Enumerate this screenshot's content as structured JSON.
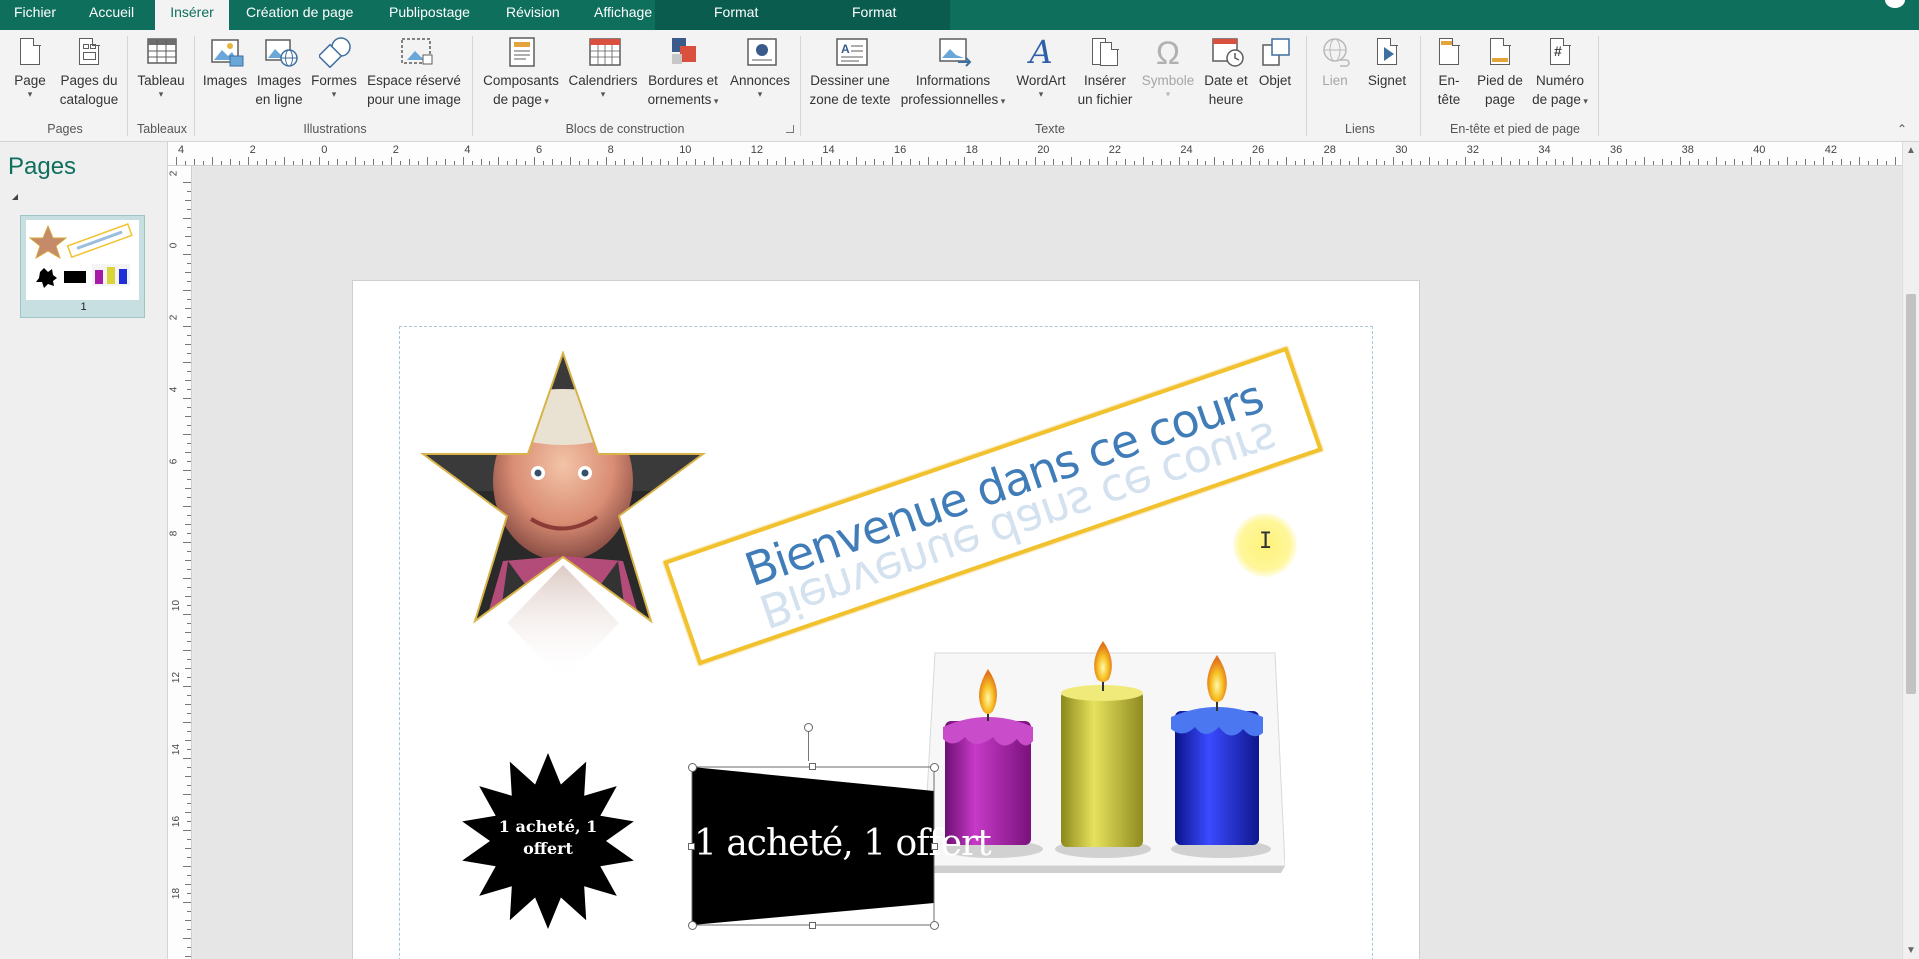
{
  "tabs": [
    {
      "label": "Fichier",
      "active": false
    },
    {
      "label": "Accueil",
      "active": false
    },
    {
      "label": "Insérer",
      "active": true
    },
    {
      "label": "Création de page",
      "active": false
    },
    {
      "label": "Publipostage",
      "active": false
    },
    {
      "label": "Révision",
      "active": false
    },
    {
      "label": "Affichage",
      "active": false
    },
    {
      "label": "Format",
      "active": false
    },
    {
      "label": "Format",
      "active": false
    }
  ],
  "ribbon": {
    "groups": {
      "pages": "Pages",
      "tableaux": "Tableaux",
      "illustrations": "Illustrations",
      "blocs": "Blocs de construction",
      "texte": "Texte",
      "liens": "Liens",
      "entete": "En-tête et pied de page"
    },
    "buttons": {
      "page": "Page",
      "pages_catalogue_1": "Pages du",
      "pages_catalogue_2": "catalogue",
      "tableau": "Tableau",
      "images": "Images",
      "images_ligne_1": "Images",
      "images_ligne_2": "en ligne",
      "formes": "Formes",
      "espace_1": "Espace réservé",
      "espace_2": "pour une image",
      "composants_1": "Composants",
      "composants_2": "de page",
      "calendriers": "Calendriers",
      "bordures_1": "Bordures et",
      "bordures_2": "ornements",
      "annonces": "Annonces",
      "dessiner_1": "Dessiner une",
      "dessiner_2": "zone de texte",
      "infos_1": "Informations",
      "infos_2": "professionnelles",
      "wordart": "WordArt",
      "inserer_fichier_1": "Insérer",
      "inserer_fichier_2": "un fichier",
      "symbole": "Symbole",
      "date_1": "Date et",
      "date_2": "heure",
      "objet": "Objet",
      "lien": "Lien",
      "signet": "Signet",
      "entete_1": "En-",
      "entete_2": "tête",
      "pied_1": "Pied de",
      "pied_2": "page",
      "numero_1": "Numéro",
      "numero_2": "de page"
    },
    "symbol_glyph": "Ω",
    "wordart_glyph": "A",
    "numero_glyph": "#"
  },
  "pages_pane": {
    "title": "Pages",
    "thumbnail_number": "1"
  },
  "ruler": {
    "h_labels": [
      "4",
      "2",
      "0",
      "2",
      "4",
      "6",
      "8",
      "10",
      "12",
      "14",
      "16",
      "18",
      "20",
      "22",
      "24",
      "26",
      "28",
      "30",
      "32",
      "34",
      "36",
      "38",
      "40",
      "42"
    ],
    "v_labels": [
      "2",
      "0",
      "2",
      "4",
      "6",
      "8",
      "10",
      "12",
      "14",
      "16",
      "18"
    ]
  },
  "document": {
    "banner_text": "Bienvenue dans ce cours",
    "burst_text_1": "1 acheté, 1",
    "burst_text_2": "offert",
    "offer_text": "1 acheté, 1 offert"
  },
  "colors": {
    "accent": "#0e6f5d",
    "banner_border": "#f2c12e",
    "banner_text": "#3f7cb8",
    "candle_purple": "#a51aa6",
    "candle_yellow": "#d9d437",
    "candle_blue": "#1f2fd8"
  }
}
